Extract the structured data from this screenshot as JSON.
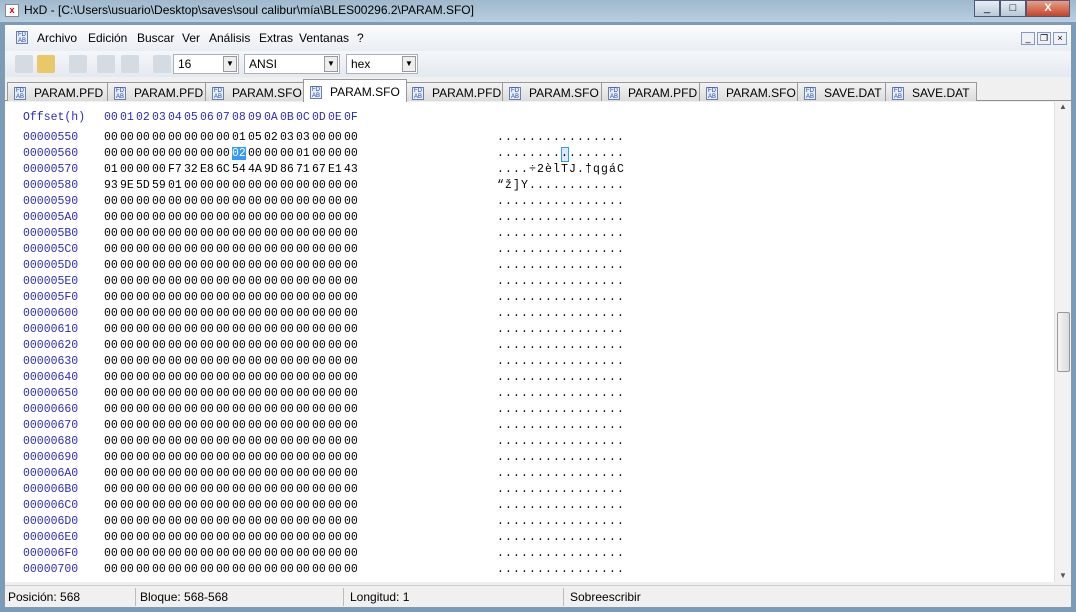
{
  "window": {
    "title": "HxD - [C:\\Users\\usuario\\Desktop\\saves\\soul calibur\\mía\\BLES00296.2\\PARAM.SFO]"
  },
  "menu": [
    "Archivo",
    "Edición",
    "Buscar",
    "Ver",
    "Análisis",
    "Extras",
    "Ventanas",
    "?"
  ],
  "toolbar": {
    "bytes_per_row": "16",
    "charset": "ANSI",
    "offset_base": "hex"
  },
  "tabs": [
    "PARAM.PFD",
    "PARAM.PFD",
    "PARAM.SFO",
    "PARAM.SFO",
    "PARAM.PFD",
    "PARAM.SFO",
    "PARAM.PFD",
    "PARAM.SFO",
    "SAVE.DAT",
    "SAVE.DAT"
  ],
  "active_tab": 3,
  "header": {
    "offset_label": "Offset(h)",
    "columns": [
      "00",
      "01",
      "02",
      "03",
      "04",
      "05",
      "06",
      "07",
      "08",
      "09",
      "0A",
      "0B",
      "0C",
      "0D",
      "0E",
      "0F"
    ]
  },
  "selection": {
    "row": 1,
    "col": 8
  },
  "rows": [
    {
      "offset": "00000550",
      "hex": "00 00 00 00 00 00 00 00 01 05 02 03 03 00 00 00",
      "ascii": "................"
    },
    {
      "offset": "00000560",
      "hex": "00 00 00 00 00 00 00 00 02 00 00 00 01 00 00 00",
      "ascii": "................"
    },
    {
      "offset": "00000570",
      "hex": "01 00 00 00 F7 32 E8 6C 54 4A 9D 86 71 67 E1 43",
      "ascii": "....÷2èlTJ.†qgáC"
    },
    {
      "offset": "00000580",
      "hex": "93 9E 5D 59 01 00 00 00 00 00 00 00 00 00 00 00",
      "ascii": "“ž]Y............"
    },
    {
      "offset": "00000590",
      "hex": "00 00 00 00 00 00 00 00 00 00 00 00 00 00 00 00",
      "ascii": "................"
    },
    {
      "offset": "000005A0",
      "hex": "00 00 00 00 00 00 00 00 00 00 00 00 00 00 00 00",
      "ascii": "................"
    },
    {
      "offset": "000005B0",
      "hex": "00 00 00 00 00 00 00 00 00 00 00 00 00 00 00 00",
      "ascii": "................"
    },
    {
      "offset": "000005C0",
      "hex": "00 00 00 00 00 00 00 00 00 00 00 00 00 00 00 00",
      "ascii": "................"
    },
    {
      "offset": "000005D0",
      "hex": "00 00 00 00 00 00 00 00 00 00 00 00 00 00 00 00",
      "ascii": "................"
    },
    {
      "offset": "000005E0",
      "hex": "00 00 00 00 00 00 00 00 00 00 00 00 00 00 00 00",
      "ascii": "................"
    },
    {
      "offset": "000005F0",
      "hex": "00 00 00 00 00 00 00 00 00 00 00 00 00 00 00 00",
      "ascii": "................"
    },
    {
      "offset": "00000600",
      "hex": "00 00 00 00 00 00 00 00 00 00 00 00 00 00 00 00",
      "ascii": "................"
    },
    {
      "offset": "00000610",
      "hex": "00 00 00 00 00 00 00 00 00 00 00 00 00 00 00 00",
      "ascii": "................"
    },
    {
      "offset": "00000620",
      "hex": "00 00 00 00 00 00 00 00 00 00 00 00 00 00 00 00",
      "ascii": "................"
    },
    {
      "offset": "00000630",
      "hex": "00 00 00 00 00 00 00 00 00 00 00 00 00 00 00 00",
      "ascii": "................"
    },
    {
      "offset": "00000640",
      "hex": "00 00 00 00 00 00 00 00 00 00 00 00 00 00 00 00",
      "ascii": "................"
    },
    {
      "offset": "00000650",
      "hex": "00 00 00 00 00 00 00 00 00 00 00 00 00 00 00 00",
      "ascii": "................"
    },
    {
      "offset": "00000660",
      "hex": "00 00 00 00 00 00 00 00 00 00 00 00 00 00 00 00",
      "ascii": "................"
    },
    {
      "offset": "00000670",
      "hex": "00 00 00 00 00 00 00 00 00 00 00 00 00 00 00 00",
      "ascii": "................"
    },
    {
      "offset": "00000680",
      "hex": "00 00 00 00 00 00 00 00 00 00 00 00 00 00 00 00",
      "ascii": "................"
    },
    {
      "offset": "00000690",
      "hex": "00 00 00 00 00 00 00 00 00 00 00 00 00 00 00 00",
      "ascii": "................"
    },
    {
      "offset": "000006A0",
      "hex": "00 00 00 00 00 00 00 00 00 00 00 00 00 00 00 00",
      "ascii": "................"
    },
    {
      "offset": "000006B0",
      "hex": "00 00 00 00 00 00 00 00 00 00 00 00 00 00 00 00",
      "ascii": "................"
    },
    {
      "offset": "000006C0",
      "hex": "00 00 00 00 00 00 00 00 00 00 00 00 00 00 00 00",
      "ascii": "................"
    },
    {
      "offset": "000006D0",
      "hex": "00 00 00 00 00 00 00 00 00 00 00 00 00 00 00 00",
      "ascii": "................"
    },
    {
      "offset": "000006E0",
      "hex": "00 00 00 00 00 00 00 00 00 00 00 00 00 00 00 00",
      "ascii": "................"
    },
    {
      "offset": "000006F0",
      "hex": "00 00 00 00 00 00 00 00 00 00 00 00 00 00 00 00",
      "ascii": "................"
    },
    {
      "offset": "00000700",
      "hex": "00 00 00 00 00 00 00 00 00 00 00 00 00 00 00 00",
      "ascii": "................"
    }
  ],
  "status": {
    "position": "Posición: 568",
    "block": "Bloque: 568-568",
    "length": "Longitud: 1",
    "mode": "Sobreescribir"
  }
}
